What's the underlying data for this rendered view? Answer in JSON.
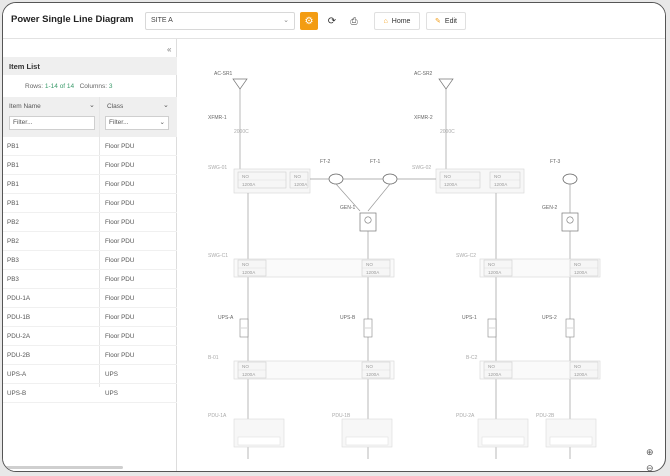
{
  "toolbar": {
    "title": "Power Single Line Diagram",
    "site_value": "SITE A",
    "home_label": "Home",
    "edit_label": "Edit"
  },
  "icons": {
    "gear": "gear-icon",
    "refresh": "refresh-icon",
    "print": "print-icon",
    "home": "home-icon",
    "edit": "edit-icon",
    "zoom_in": "zoom-in-icon",
    "zoom_out": "zoom-out-icon"
  },
  "colors": {
    "accent": "#f39c12",
    "count": "#3a9a6a"
  },
  "item_list": {
    "title": "Item List",
    "rows_label": "Rows:",
    "rows_value": "1-14 of 14",
    "columns_label": "Columns:",
    "columns_value": "3",
    "columns": [
      {
        "title": "Item Name",
        "filter_placeholder": "Filter..."
      },
      {
        "title": "Class",
        "filter_placeholder": "Filter..."
      }
    ],
    "rows": [
      [
        "PB1",
        "Floor PDU"
      ],
      [
        "PB1",
        "Floor PDU"
      ],
      [
        "PB1",
        "Floor PDU"
      ],
      [
        "PB1",
        "Floor PDU"
      ],
      [
        "PB2",
        "Floor PDU"
      ],
      [
        "PB2",
        "Floor PDU"
      ],
      [
        "PB3",
        "Floor PDU"
      ],
      [
        "PB3",
        "Floor PDU"
      ],
      [
        "PDU-1A",
        "Floor PDU"
      ],
      [
        "PDU-1B",
        "Floor PDU"
      ],
      [
        "PDU-2A",
        "Floor PDU"
      ],
      [
        "PDU-2B",
        "Floor PDU"
      ],
      [
        "UPS-A",
        "UPS"
      ],
      [
        "UPS-B",
        "UPS"
      ]
    ]
  },
  "diagram": {
    "labels": {
      "ac_sr1": "AC-SR1",
      "ac_sr2": "AC-SR2",
      "xfmr1": "XFMR-1",
      "xfmr2": "XFMR-2",
      "xfmr1_rating": "2000C",
      "xfmr2_rating": "2000C",
      "swg01": "SWG-01",
      "swg02": "SWG-02",
      "ft2": "FT-2",
      "ft1": "FT-1",
      "ft3": "FT-3",
      "gen1": "GEN-1",
      "gen2": "GEN-2",
      "swg_c1": "SWG-C1",
      "swg_c2": "SWG-C2",
      "ups_a": "UPS-A",
      "ups_b": "UPS-B",
      "ups_1": "UPS-1",
      "ups_2": "UPS-2",
      "b01": "B-01",
      "b02": "B-C2",
      "pdu_1a": "PDU-1A",
      "pdu_1b": "PDU-1B",
      "pdu_2a": "PDU-2A",
      "pdu_2b": "PDU-2B"
    },
    "breaker": {
      "state": "NO",
      "rating": "1200A"
    }
  }
}
